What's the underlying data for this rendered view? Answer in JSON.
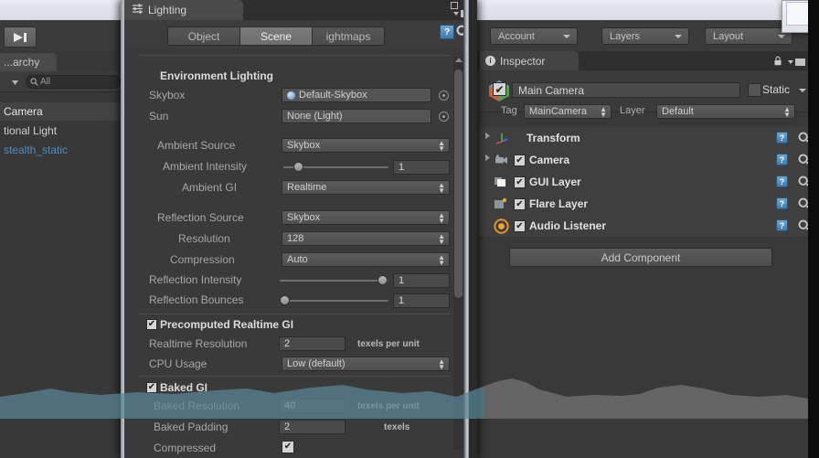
{
  "hierarchy": {
    "tab_label": "...archy",
    "search_placeholder": "All",
    "search_icon": "search-icon",
    "items": [
      {
        "label": "Camera"
      },
      {
        "label": "tional Light"
      },
      {
        "label": "stealth_static"
      }
    ]
  },
  "toolbar": {
    "step_icon": "step-forward-icon"
  },
  "lighting_window": {
    "title": "Lighting",
    "title_icon": "sliders-icon",
    "menu_icon": "panel-menu-icon",
    "maximize_icon": "maximize-icon",
    "close_icon": "close-icon",
    "help_icon": "help-icon",
    "gear_icon": "gear-icon",
    "tabs": [
      {
        "label": "Object",
        "active": false
      },
      {
        "label": "Scene",
        "active": true
      },
      {
        "label": "ightmaps",
        "active": false
      }
    ],
    "sections": [
      {
        "title": "Environment Lighting",
        "rows": [
          {
            "label": "Skybox",
            "type": "object",
            "value": "Default-Skybox",
            "has_swatch": true
          },
          {
            "label": "Sun",
            "type": "object",
            "value": "None (Light)",
            "has_swatch": false
          },
          {
            "label": "Ambient Source",
            "type": "dropdown",
            "value": "Skybox"
          },
          {
            "label": "Ambient Intensity",
            "type": "slider",
            "value": "1",
            "knob_pct": 8
          },
          {
            "label": "Ambient GI",
            "type": "dropdown",
            "value": "Realtime"
          },
          {
            "label": "Reflection Source",
            "type": "dropdown",
            "value": "Skybox"
          },
          {
            "label": "Resolution",
            "type": "dropdown",
            "value": "128",
            "indent": true
          },
          {
            "label": "Compression",
            "type": "dropdown",
            "value": "Auto",
            "indent": true
          },
          {
            "label": "Reflection Intensity",
            "type": "slider",
            "value": "1",
            "knob_pct": 92
          },
          {
            "label": "Reflection Bounces",
            "type": "slider",
            "value": "1",
            "knob_pct": 4
          }
        ]
      },
      {
        "title": "Precomputed Realtime GI",
        "checked": true,
        "rows": [
          {
            "label": "Realtime Resolution",
            "type": "textbox",
            "value": "2",
            "unit": "texels per unit"
          },
          {
            "label": "CPU Usage",
            "type": "dropdown",
            "value": "Low (default)"
          }
        ]
      },
      {
        "title": "Baked GI",
        "checked": true,
        "rows": [
          {
            "label": "Baked Resolution",
            "type": "textbox",
            "value": "40",
            "unit": "texels per unit"
          },
          {
            "label": "Baked Padding",
            "type": "textbox",
            "value": "2",
            "unit": "texels"
          },
          {
            "label": "Compressed",
            "type": "checkbox",
            "checked": true
          }
        ]
      }
    ]
  },
  "inspector": {
    "toolbar": [
      {
        "label": "Account"
      },
      {
        "label": "Layers"
      },
      {
        "label": "Layout"
      }
    ],
    "tab_label": "Inspector",
    "tab_icon": "info-icon",
    "lock_icon": "lock-icon",
    "menu_icon": "panel-menu-icon",
    "gameobject": {
      "name": "Main Camera",
      "enabled": true,
      "icon": "prefab-cube-icon",
      "static_label": "Static",
      "static_checked": false,
      "tag_label": "Tag",
      "tag_value": "MainCamera",
      "layer_label": "Layer",
      "layer_value": "Default"
    },
    "components": [
      {
        "name": "Transform",
        "icon": "transform-icon",
        "has_enable": false
      },
      {
        "name": "Camera",
        "icon": "camera-icon",
        "has_enable": true,
        "enabled": true
      },
      {
        "name": "GUI Layer",
        "icon": "gui-layer-icon",
        "has_enable": true,
        "enabled": true
      },
      {
        "name": "Flare Layer",
        "icon": "flare-layer-icon",
        "has_enable": true,
        "enabled": true
      },
      {
        "name": "Audio Listener",
        "icon": "audio-listener-icon",
        "has_enable": true,
        "enabled": true
      }
    ],
    "add_component_label": "Add Component",
    "help_icon": "help-icon",
    "gear_icon": "gear-icon"
  },
  "colors": {
    "panel_bg": "#393939",
    "window_bg": "#3a3a3a",
    "accent_blue": "#4d8fc4",
    "overlay_band": "#5c8699",
    "field_bg": "#545454"
  }
}
